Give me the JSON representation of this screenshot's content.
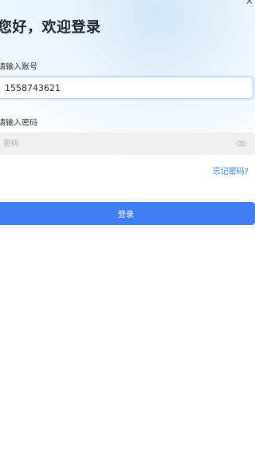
{
  "header": {
    "title": "您好，欢迎登录",
    "close_mark": "×"
  },
  "account": {
    "label": "请输入账号",
    "value": "1558743621"
  },
  "password": {
    "label": "请输入密码",
    "placeholder": "密码",
    "visibility_icon": "eye-icon"
  },
  "forgot_link": "忘记密码?",
  "login_button": "登录",
  "colors": {
    "accent": "#3f7ff5",
    "link": "#3a7df0",
    "title": "#1f2329",
    "input_bg": "#f0f0f0"
  }
}
